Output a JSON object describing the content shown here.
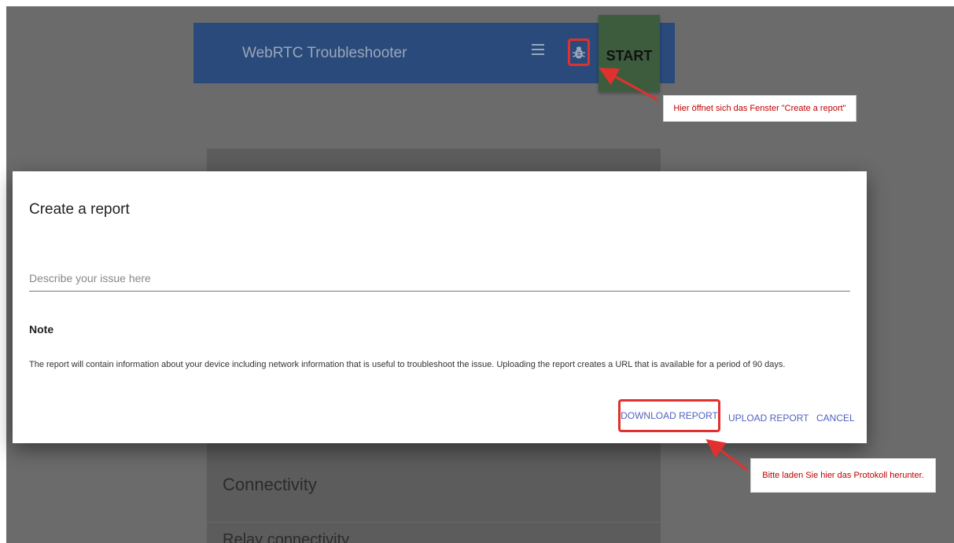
{
  "app_bar": {
    "title": "WebRTC Troubleshooter",
    "start_label": "START"
  },
  "background_cards": {
    "section_label": "Connectivity",
    "next_item_label": "Relay connectivity"
  },
  "dialog": {
    "title": "Create a report",
    "input_placeholder": "Describe your issue here",
    "note_heading": "Note",
    "note_text": "The report will contain information about your device including network information that is useful to troubleshoot the issue. Uploading the report creates a URL that is available for a period of 90 days.",
    "download_label": "DOWNLOAD REPORT",
    "upload_label": "UPLOAD REPORT",
    "cancel_label": "CANCEL"
  },
  "annotations": {
    "top_callout": "Hier öffnet sich das Fenster \"Create a report\"",
    "bottom_callout": "Bitte laden Sie hier das Protokoll herunter.",
    "highlight_color": "#e0312f"
  },
  "icons": {
    "menu": "menu-icon",
    "bug": "bug-report-icon"
  }
}
